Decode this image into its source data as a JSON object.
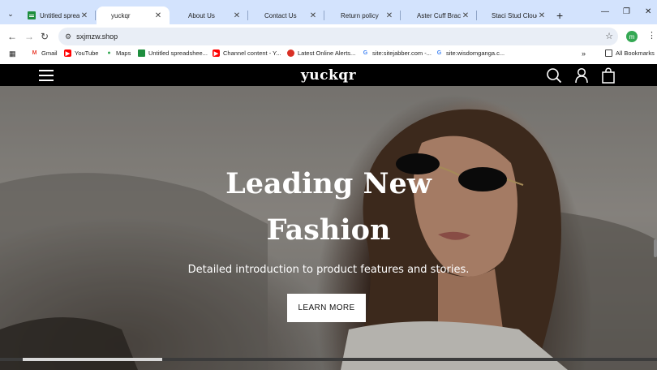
{
  "browser": {
    "tabs": [
      {
        "label": "Untitled spreadsh",
        "icon": "sheets-icon",
        "active": false
      },
      {
        "label": "yuckqr",
        "icon": "",
        "active": true
      },
      {
        "label": "About Us",
        "icon": "",
        "active": false
      },
      {
        "label": "Contact Us",
        "icon": "",
        "active": false
      },
      {
        "label": "Return policy",
        "icon": "",
        "active": false
      },
      {
        "label": "Aster Cuff Bracel",
        "icon": "",
        "active": false
      },
      {
        "label": "Staci Stud Cloud",
        "icon": "",
        "active": false
      }
    ],
    "url": "sxjmzw.shop",
    "profile_initial": "m",
    "bookmarks": [
      {
        "label": "Gmail",
        "icon": "gmail-icon"
      },
      {
        "label": "YouTube",
        "icon": "youtube-icon"
      },
      {
        "label": "Maps",
        "icon": "maps-icon"
      },
      {
        "label": "Untitled spreadshee...",
        "icon": "sheets-icon"
      },
      {
        "label": "Channel content - Y...",
        "icon": "youtube-icon"
      },
      {
        "label": "Latest Online Alerts...",
        "icon": "alert-icon"
      },
      {
        "label": "site:sitejabber.com -...",
        "icon": "google-icon"
      },
      {
        "label": "site:wisdomganga.c...",
        "icon": "google-icon"
      }
    ],
    "all_bookmarks": "All Bookmarks"
  },
  "site": {
    "logo": "yuckqr",
    "hero": {
      "title_line1": "Leading New",
      "title_line2": "Fashion",
      "subtitle": "Detailed introduction to product features and stories.",
      "cta": "LEARN MORE"
    }
  }
}
